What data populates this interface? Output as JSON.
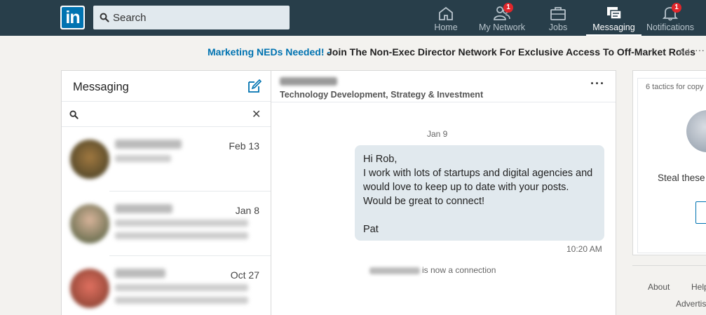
{
  "nav": {
    "logo_text": "in",
    "search_placeholder": "Search",
    "items": [
      {
        "label": "Home",
        "icon": "home-icon"
      },
      {
        "label": "My Network",
        "icon": "network-icon",
        "badge": "1"
      },
      {
        "label": "Jobs",
        "icon": "briefcase-icon"
      },
      {
        "label": "Messaging",
        "icon": "messaging-icon",
        "active": true
      },
      {
        "label": "Notifications",
        "icon": "bell-icon",
        "badge": "1"
      }
    ]
  },
  "ad": {
    "link": "Marketing NEDs Needed! -",
    "text": "Join The Non-Exec Director Network For Exclusive Access To Off-Market Roles",
    "tag": "Ad",
    "more": "···"
  },
  "messaging": {
    "title": "Messaging",
    "clear": "✕",
    "conversations": [
      {
        "date": "Feb 13"
      },
      {
        "date": "Jan 8"
      },
      {
        "date": "Oct 27"
      }
    ]
  },
  "chat": {
    "subtitle": "Technology Development, Strategy & Investment",
    "more": "···",
    "date": "Jan 9",
    "message": "Hi Rob,\nI work with lots of startups and digital agencies and\nwould love to keep up to date with your posts.\nWould be great to connect!\n\nPat",
    "time": "10:20 AM",
    "connection_text": "is now a connection"
  },
  "rail": {
    "tactics": "6 tactics for copy",
    "steal": "Steal these",
    "footer": {
      "about": "About",
      "help": "Help",
      "advertising": "Advertis"
    }
  },
  "colors": {
    "nav_bg": "#283e4a",
    "brand_blue": "#0073b1",
    "badge_red": "#e0262b",
    "bubble_bg": "#e1e9ee"
  }
}
